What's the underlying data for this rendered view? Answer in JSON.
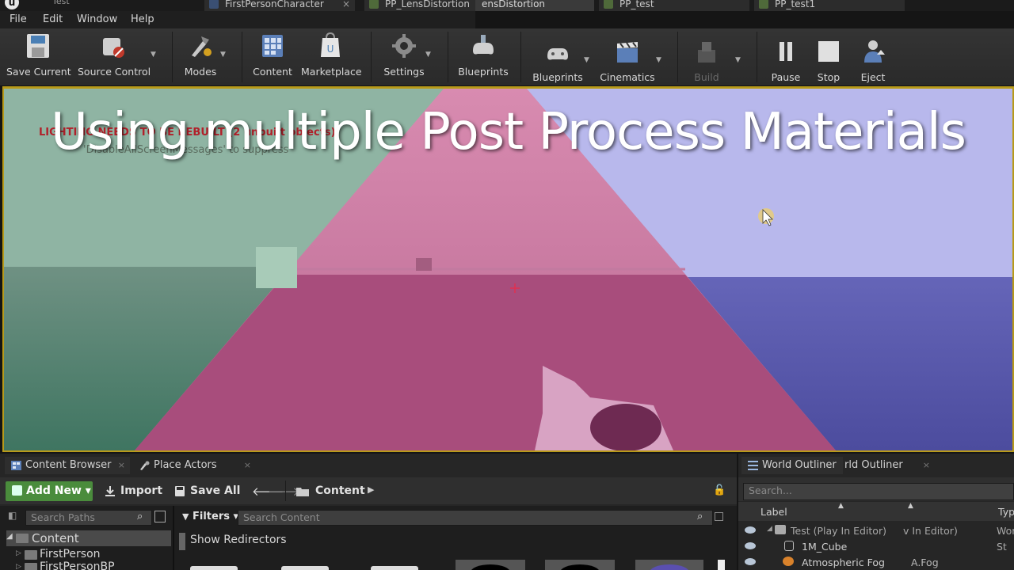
{
  "window": {
    "app_logo": "u",
    "project_title": "Test",
    "tabs": [
      {
        "label": "FirstPersonCharacter"
      },
      {
        "label": "PP_LensDistortion"
      },
      {
        "label": "ensDistortion"
      },
      {
        "label": "PP_test"
      },
      {
        "label": "PP_test1"
      }
    ]
  },
  "menu": {
    "items": [
      "File",
      "Edit",
      "Window",
      "Help"
    ]
  },
  "toolbar": {
    "save_current": "Save Current",
    "source_control": "Source Control",
    "modes": "Modes",
    "content": "Content",
    "marketplace": "Marketplace",
    "settings": "Settings",
    "blueprints_1": "Blueprints",
    "blueprints_2": "Blueprints",
    "cinematics": "Cinematics",
    "build": "Build",
    "pause": "Pause",
    "stop": "Stop",
    "eject": "Eject"
  },
  "viewport": {
    "overlay_title": "Using multiple Post Process Materials",
    "lighting_message": "LIGHTING NEEDS TO BE REBUILT (2 unbuilt objects)",
    "disable_message": "'DisableAllScreenMessages' to suppress"
  },
  "content_browser": {
    "tabs": {
      "content_browser": "Content Browser",
      "place_actors": "Place Actors"
    },
    "add_new": "Add New",
    "import": "Import",
    "save_all": "Save All",
    "path_root": "Content",
    "search_paths_placeholder": "Search Paths",
    "filters": "Filters",
    "search_content_placeholder": "Search Content",
    "show_redirectors": "Show Redirectors",
    "tree": [
      "Content",
      "FirstPerson",
      "FirstPersonBP"
    ]
  },
  "world_outliner": {
    "tabs": {
      "outliner_1": "World Outliner",
      "outliner_2": "rld Outliner"
    },
    "search_placeholder": "Search...",
    "columns": {
      "label": "Label",
      "type": "Typ"
    },
    "rows": [
      {
        "label": "Test (Play In Editor)",
        "extra": "v In Editor)",
        "type": "Wor"
      },
      {
        "label": "1M_Cube",
        "extra": "",
        "type": "St"
      },
      {
        "label": "Atmospheric Fog",
        "extra": "A.Fog",
        "type": ""
      }
    ]
  },
  "colors": {
    "green_tint": "#7fa090",
    "pink_tint": "#b65a86",
    "blue_tint": "#a9a9e0",
    "add_new_green": "#4a8c3c",
    "viewport_border": "#b89a1a"
  }
}
